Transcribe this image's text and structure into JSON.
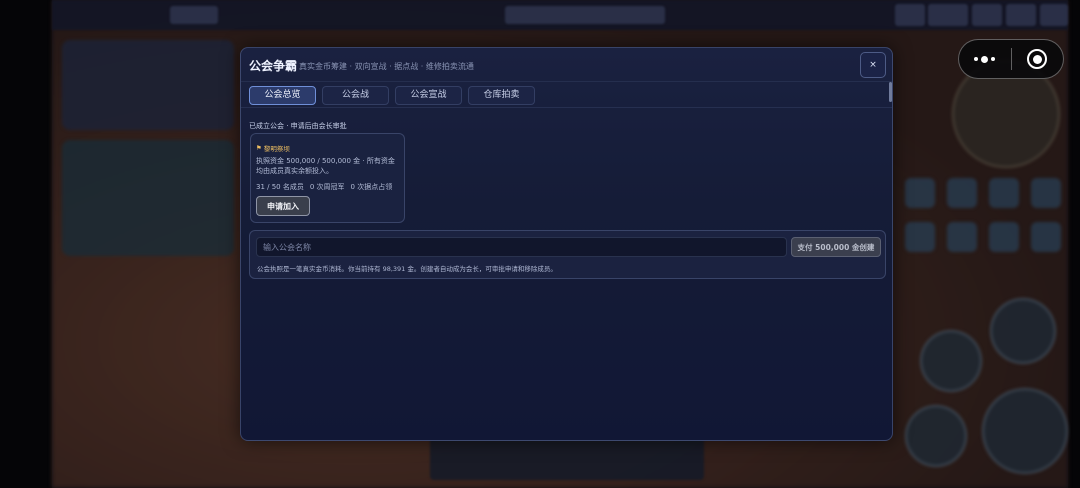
{
  "modal": {
    "title": "公会争霸",
    "subtitle": "真实金币筹建 · 双向宣战 · 据点战 · 维修拍卖流通",
    "close_label": "×"
  },
  "tabs": [
    {
      "label": "公会总览",
      "active": true
    },
    {
      "label": "公会战",
      "active": false
    },
    {
      "label": "公会宣战",
      "active": false
    },
    {
      "label": "仓库拍卖",
      "active": false
    }
  ],
  "overview": {
    "section_label": "已成立公会 · 申请后由会长审批",
    "guild": {
      "name": "黎明祭坝",
      "description": "执照资金 500,000 / 500,000 金 · 所有资金均由成员真实余额投入。",
      "members": "31 / 50 名成员",
      "wins": "0 次周冠军",
      "captures": "0 次据点占领",
      "apply_label": "申请加入"
    },
    "create": {
      "placeholder": "输入公会名称",
      "pay_label": "支付 500,000 金创建",
      "note": "公会执照是一笔真实金币消耗。你当前持有 98,391 金。创建者自动成为会长，可审批申请和移除成员。"
    }
  },
  "icons": {
    "close": "close-icon",
    "flag": "flag-icon",
    "menu": "more-dots-icon",
    "exit": "exit-target-icon"
  }
}
